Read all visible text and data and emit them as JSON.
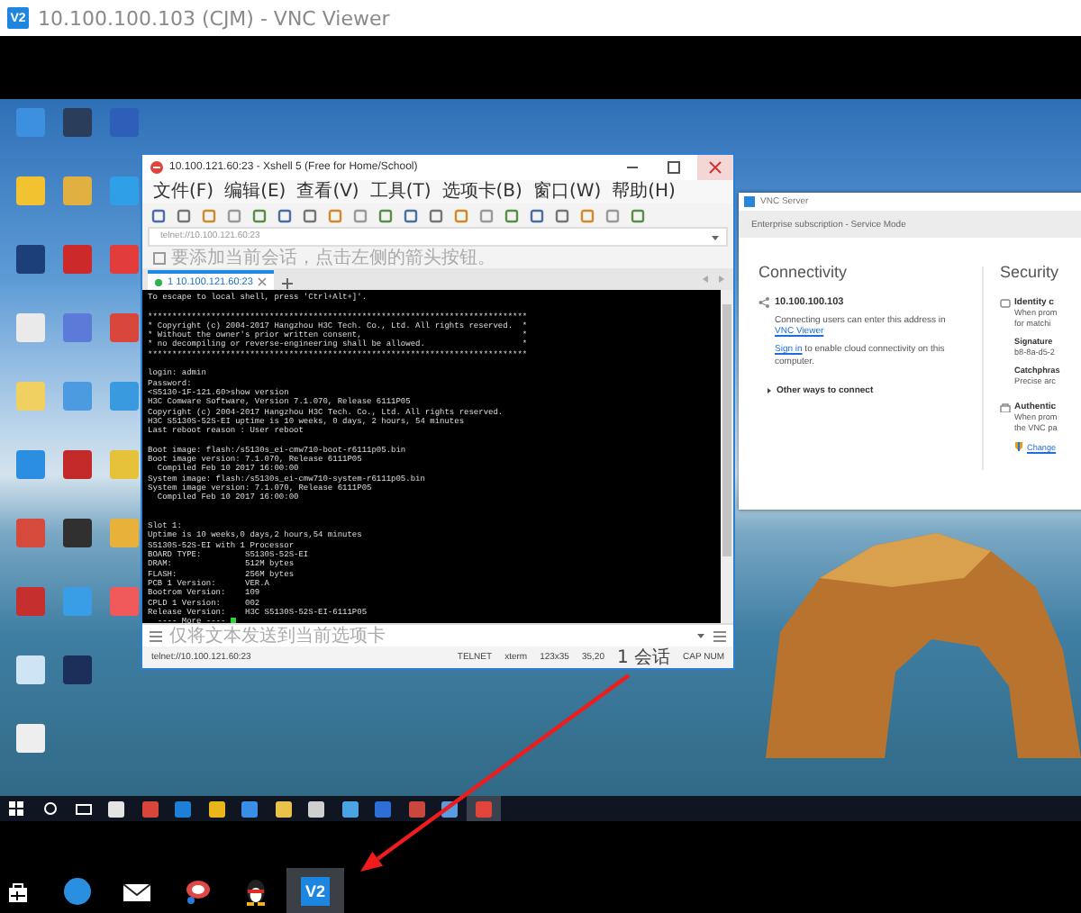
{
  "window": {
    "logo_text": "V2",
    "title": "10.100.100.103 (CJM) - VNC Viewer"
  },
  "xshell": {
    "title": "10.100.121.60:23 - Xshell 5 (Free for Home/School)",
    "menu": [
      "文件(F)",
      "编辑(E)",
      "查看(V)",
      "工具(T)",
      "选项卡(B)",
      "窗口(W)",
      "帮助(H)"
    ],
    "address": "telnet://10.100.121.60:23",
    "hint": "要添加当前会话，点击左侧的箭头按钮。",
    "tabs": [
      {
        "label": "1 10.100.121.60:23",
        "selected": true
      }
    ],
    "terminal": {
      "blocks": [
        {
          "kind": "normal",
          "lines": [
            "To escape to local shell, press 'Ctrl+Alt+]'."
          ]
        },
        {
          "kind": "normal",
          "lines": [
            "******************************************************************************",
            "* Copyright (c) 2004-2017 Hangzhou H3C Tech. Co., Ltd. All rights reserved.  *",
            "* Without the owner's prior written consent,                                 *",
            "* no decompiling or reverse-engineering shall be allowed.                    *",
            "******************************************************************************"
          ]
        },
        {
          "kind": "normal",
          "lines": [
            "login: admin",
            "Password:",
            "<S5130-1F-121.60>show version",
            "H3C Comware Software, Version 7.1.070, Release 6111P05",
            "Copyright (c) 2004-2017 Hangzhou H3C Tech. Co., Ltd. All rights reserved.",
            "H3C S5130S-52S-EI uptime is 10 weeks, 0 days, 2 hours, 54 minutes",
            "Last reboot reason : User reboot"
          ]
        },
        {
          "kind": "normal",
          "lines": [
            "Boot image: flash:/s5130s_ei-cmw710-boot-r6111p05.bin",
            "Boot image version: 7.1.070, Release 6111P05",
            "  Compiled Feb 10 2017 16:00:00",
            "System image: flash:/s5130s_ei-cmw710-system-r6111p05.bin",
            "System image version: 7.1.070, Release 6111P05",
            "  Compiled Feb 10 2017 16:00:00"
          ]
        },
        {
          "kind": "spaced",
          "lines": [
            "Slot 1:",
            "Uptime is 10 weeks,0 days,2 hours,54 minutes",
            "S5130S-52S-EI with 1 Processor",
            "BOARD TYPE:         S5130S-52S-EI",
            "DRAM:               512M bytes",
            "FLASH:              256M bytes",
            "PCB 1 Version:      VER.A",
            "Bootrom Version:    109",
            "CPLD 1 Version:     002",
            "Release Version:    H3C S5130S-52S-EI-6111P05"
          ]
        }
      ],
      "prompt": "  ---- More ----",
      "cursor_visible": true
    },
    "send_bar": "仅将文本发送到当前选项卡",
    "status": [
      "telnet://10.100.121.60:23",
      "TELNET",
      "xterm",
      "123x35",
      "35,20",
      "1 会话",
      "CAP NUM"
    ]
  },
  "vnc_server": {
    "title": "VNC Server",
    "subscription": "Enterprise subscription - Service Mode",
    "connectivity": {
      "heading": "Connectivity",
      "address": "10.100.100.103",
      "address_note": "Connecting users can enter this address in ",
      "address_link": "VNC Viewer",
      "signin_link": "Sign in",
      "signin_note": " to enable cloud connectivity on this computer.",
      "other_ways": "Other ways to connect"
    },
    "security": {
      "heading": "Security",
      "items": [
        {
          "kind": "section",
          "text": "Identity c"
        },
        {
          "kind": "text",
          "text": "When prom"
        },
        {
          "kind": "text",
          "text": "for matchi"
        },
        {
          "kind": "label",
          "text": "Signature"
        },
        {
          "kind": "text",
          "text": "b8-8a-d5-2"
        },
        {
          "kind": "label",
          "text": "Catchphras"
        },
        {
          "kind": "text",
          "text": "Precise arc"
        },
        {
          "kind": "section",
          "text": "Authentic"
        },
        {
          "kind": "text",
          "text": "When prom"
        },
        {
          "kind": "text",
          "text": "the VNC pa"
        },
        {
          "kind": "link",
          "text": "Change"
        }
      ]
    }
  },
  "remote_taskbar": [
    {
      "kind": "windows",
      "selected": false
    },
    {
      "kind": "search",
      "selected": false
    },
    {
      "kind": "task_view",
      "selected": false
    },
    {
      "kind": "app",
      "color": "#e4e4e4",
      "selected": false
    },
    {
      "kind": "app",
      "color": "#d8463b",
      "selected": false
    },
    {
      "kind": "app",
      "color": "#1e7fd8",
      "selected": false
    },
    {
      "kind": "app",
      "color": "#e8b51b",
      "selected": false
    },
    {
      "kind": "app",
      "color": "#3a8ee6",
      "selected": false
    },
    {
      "kind": "app",
      "color": "#e8c24a",
      "selected": false
    },
    {
      "kind": "app",
      "color": "#cfcfcf",
      "selected": false
    },
    {
      "kind": "app",
      "color": "#4ba3e3",
      "selected": false
    },
    {
      "kind": "app",
      "color": "#2d6fd6",
      "selected": false
    },
    {
      "kind": "app",
      "color": "#c9473c",
      "selected": false
    },
    {
      "kind": "app",
      "color": "#5b9be0",
      "selected": false
    },
    {
      "kind": "app",
      "color": "#e0443a",
      "selected": true
    }
  ],
  "taskbar": [
    {
      "kind": "store",
      "selected": false
    },
    {
      "kind": "browser",
      "selected": false
    },
    {
      "kind": "mail",
      "selected": false
    },
    {
      "kind": "bird",
      "selected": false
    },
    {
      "kind": "penguin",
      "selected": false
    },
    {
      "kind": "vnc",
      "label": "V2",
      "selected": true
    }
  ]
}
